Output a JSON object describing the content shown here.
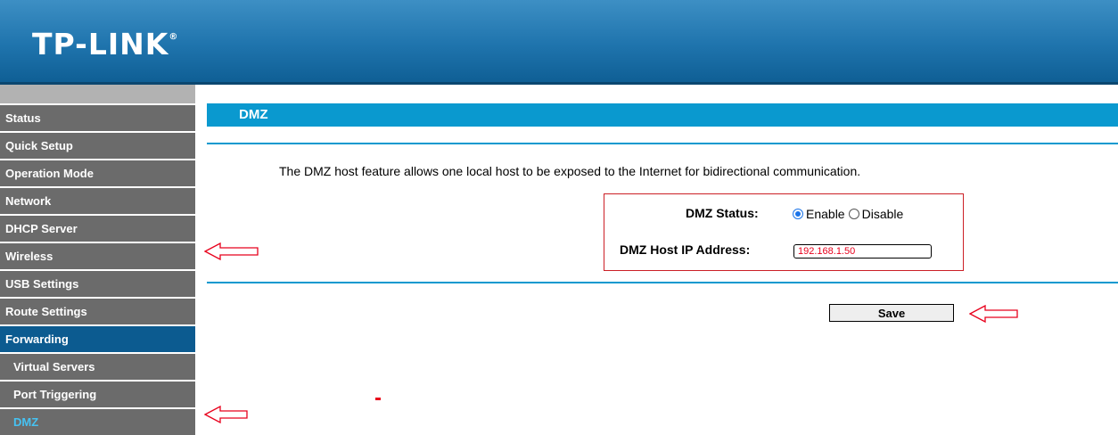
{
  "header": {
    "brand": "TP-LINK",
    "trademark": "®"
  },
  "sidebar": {
    "items": [
      {
        "label": "Status",
        "state": "normal"
      },
      {
        "label": "Quick Setup",
        "state": "normal"
      },
      {
        "label": "Operation Mode",
        "state": "normal"
      },
      {
        "label": "Network",
        "state": "normal"
      },
      {
        "label": "DHCP Server",
        "state": "normal"
      },
      {
        "label": "Wireless",
        "state": "normal"
      },
      {
        "label": "USB Settings",
        "state": "normal"
      },
      {
        "label": "Route Settings",
        "state": "normal"
      },
      {
        "label": "Forwarding",
        "state": "active"
      },
      {
        "label": "Virtual Servers",
        "state": "sub"
      },
      {
        "label": "Port Triggering",
        "state": "sub"
      },
      {
        "label": "DMZ",
        "state": "current"
      }
    ]
  },
  "page": {
    "title": "DMZ",
    "description": "The DMZ host feature allows one local host to be exposed to the Internet for bidirectional communication."
  },
  "form": {
    "status_label": "DMZ Status:",
    "enable_label": "Enable",
    "disable_label": "Disable",
    "selected": "Enable",
    "host_ip_label": "DMZ Host IP Address:",
    "host_ip_value": "192.168.1.50"
  },
  "actions": {
    "save_label": "Save"
  },
  "colors": {
    "header_blue": "#1f74ad",
    "title_bar": "#0a99cf",
    "sidebar_gray": "#6b6b6b",
    "active_menu": "#0c5b90",
    "current_menu_text": "#46c2f2",
    "annotation_red": "#e8001c"
  },
  "annotations": [
    "arrow-icon",
    "arrow-icon",
    "arrow-icon"
  ]
}
